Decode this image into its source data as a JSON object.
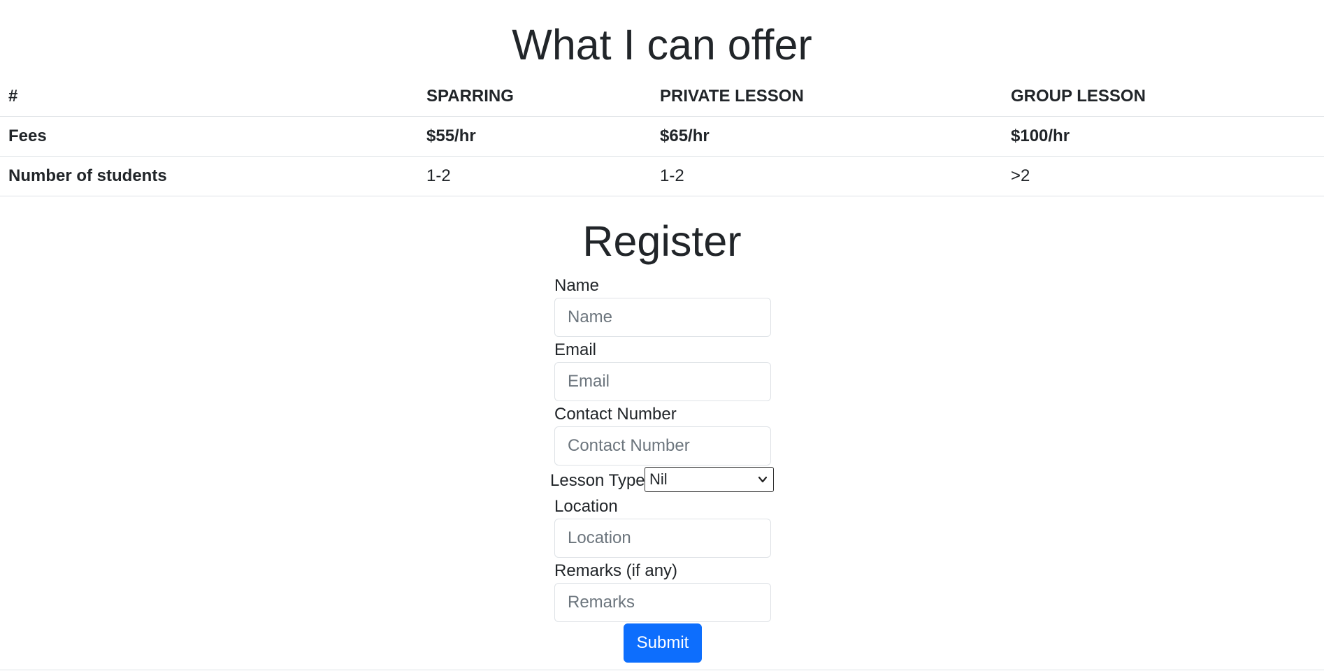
{
  "offer": {
    "title": "What I can offer",
    "columns": [
      "#",
      "SPARRING",
      "PRIVATE LESSON",
      "GROUP LESSON"
    ],
    "rows": [
      {
        "label": "Fees",
        "values": [
          "$55/hr",
          "$65/hr",
          "$100/hr"
        ]
      },
      {
        "label": "Number of students",
        "values": [
          "1-2",
          "1-2",
          ">2"
        ]
      }
    ]
  },
  "register": {
    "title": "Register",
    "name_label": "Name",
    "name_placeholder": "Name",
    "email_label": "Email",
    "email_placeholder": "Email",
    "contact_label": "Contact Number",
    "contact_placeholder": "Contact Number",
    "lesson_type_label": "Lesson Type",
    "lesson_type_value": "Nil",
    "location_label": "Location",
    "location_placeholder": "Location",
    "remarks_label": "Remarks (if any)",
    "remarks_placeholder": "Remarks",
    "submit_label": "Submit"
  },
  "colors": {
    "primary": "#0d6efd",
    "text": "#212529",
    "border": "#dee2e6"
  }
}
